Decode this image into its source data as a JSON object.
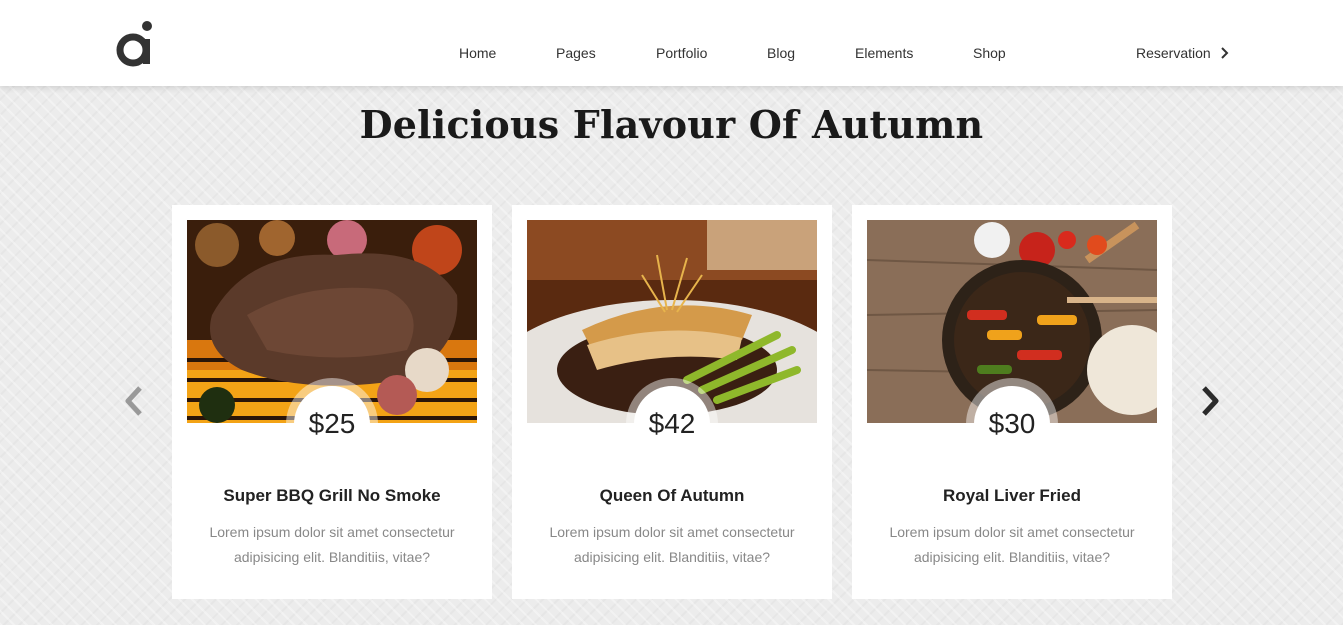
{
  "header": {
    "nav": [
      {
        "label": "Home"
      },
      {
        "label": "Pages"
      },
      {
        "label": "Portfolio"
      },
      {
        "label": "Blog"
      },
      {
        "label": "Elements"
      },
      {
        "label": "Shop"
      }
    ],
    "reservation_label": "Reservation"
  },
  "section": {
    "title": "Delicious Flavour Of Autumn"
  },
  "cards": [
    {
      "price": "$25",
      "title": "Super BBQ Grill No Smoke",
      "desc": "Lorem ipsum dolor sit amet consectetur adipisicing elit. Blanditiis, vitae?"
    },
    {
      "price": "$42",
      "title": "Queen Of Autumn",
      "desc": "Lorem ipsum dolor sit amet consectetur adipisicing elit. Blanditiis, vitae?"
    },
    {
      "price": "$30",
      "title": "Royal Liver Fried",
      "desc": "Lorem ipsum dolor sit amet consectetur adipisicing elit. Blanditiis, vitae?"
    }
  ],
  "icons": {
    "logo": "logo-icon",
    "reservation": "chevron-right-icon",
    "prev": "chevron-left-icon",
    "next": "chevron-right-icon"
  },
  "colors": {
    "background": "#ececec",
    "text": "#222222",
    "muted": "#888888",
    "arrow_prev": "#999999",
    "arrow_next": "#2b2b2b"
  }
}
